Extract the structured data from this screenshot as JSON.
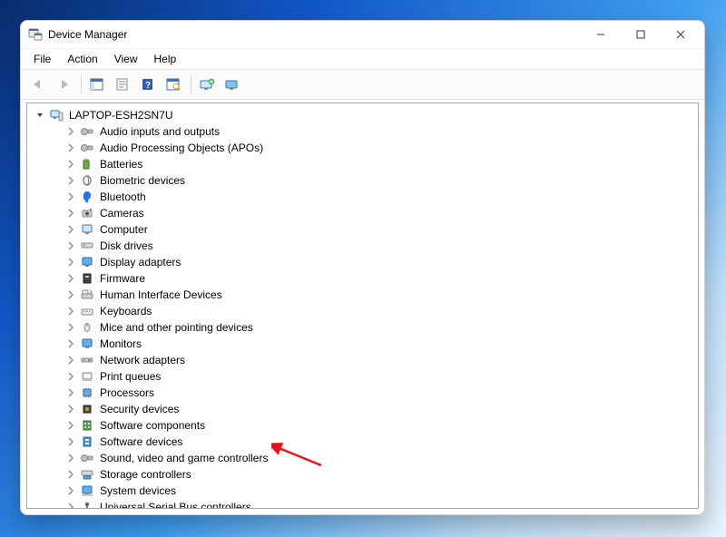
{
  "window": {
    "title": "Device Manager"
  },
  "menu": {
    "file": "File",
    "action": "Action",
    "view": "View",
    "help": "Help"
  },
  "tree": {
    "root": "LAPTOP-ESH2SN7U",
    "items": [
      {
        "label": "Audio inputs and outputs"
      },
      {
        "label": "Audio Processing Objects (APOs)"
      },
      {
        "label": "Batteries"
      },
      {
        "label": "Biometric devices"
      },
      {
        "label": "Bluetooth"
      },
      {
        "label": "Cameras"
      },
      {
        "label": "Computer"
      },
      {
        "label": "Disk drives"
      },
      {
        "label": "Display adapters"
      },
      {
        "label": "Firmware"
      },
      {
        "label": "Human Interface Devices"
      },
      {
        "label": "Keyboards"
      },
      {
        "label": "Mice and other pointing devices"
      },
      {
        "label": "Monitors"
      },
      {
        "label": "Network adapters"
      },
      {
        "label": "Print queues"
      },
      {
        "label": "Processors"
      },
      {
        "label": "Security devices"
      },
      {
        "label": "Software components"
      },
      {
        "label": "Software devices"
      },
      {
        "label": "Sound, video and game controllers"
      },
      {
        "label": "Storage controllers"
      },
      {
        "label": "System devices"
      },
      {
        "label": "Universal Serial Bus controllers"
      }
    ]
  },
  "annotation": {
    "arrow_target_index": 20
  }
}
